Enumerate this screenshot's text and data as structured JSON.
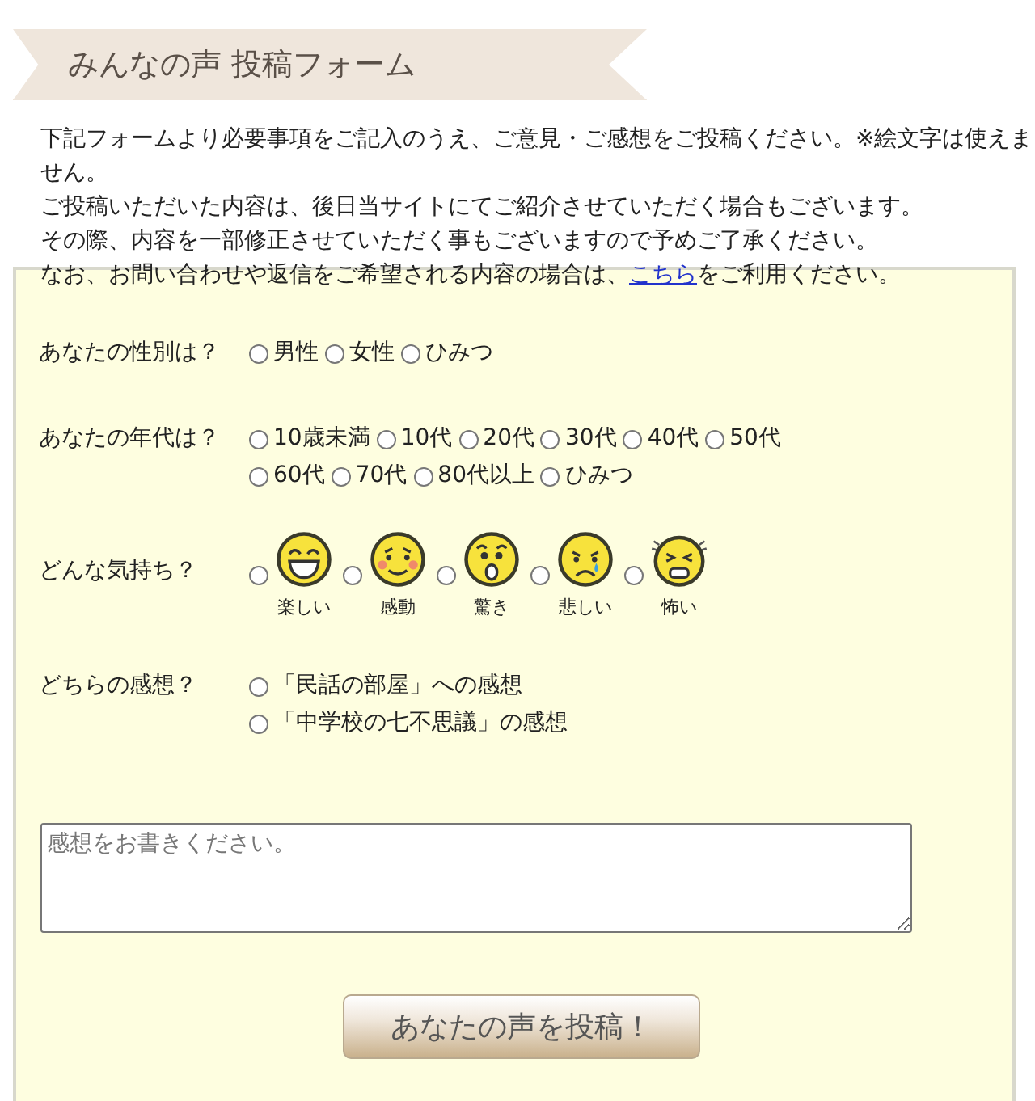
{
  "banner": {
    "title": "みんなの声 投稿フォーム"
  },
  "intro": {
    "lines": [
      {
        "text": "下記フォームより必要事項をご記入のうえ、ご意見・ご感想をご投稿ください。※絵文字は使えません。"
      },
      {
        "text": "ご投稿いただいた内容は、後日当サイトにてご紹介させていただく場合もございます。"
      },
      {
        "text": "その際、内容を一部修正させていただく事もございますので予めご了承ください。"
      },
      {
        "text": "なお、お問い合わせや返信をご希望される内容の場合は、",
        "link": "こちら",
        "after": "をご利用ください。"
      }
    ]
  },
  "questions": [
    {
      "kind": "inline",
      "label": "あなたの性別は？",
      "options": [
        {
          "label": "男性",
          "selected": false
        },
        {
          "label": "女性",
          "selected": false
        },
        {
          "label": "ひみつ",
          "selected": false
        }
      ]
    },
    {
      "kind": "inline",
      "label": "あなたの年代は？",
      "options": [
        {
          "label": "10歳未満",
          "selected": false
        },
        {
          "label": "10代",
          "selected": false
        },
        {
          "label": "20代",
          "selected": false
        },
        {
          "label": "30代",
          "selected": false
        },
        {
          "label": "40代",
          "selected": false
        },
        {
          "label": "50代",
          "selected": false
        },
        {
          "label": "60代",
          "selected": false
        },
        {
          "label": "70代",
          "selected": false
        },
        {
          "label": "80代以上",
          "selected": false
        },
        {
          "label": "ひみつ",
          "selected": false
        }
      ]
    },
    {
      "kind": "faces",
      "label": "どんな気持ち？",
      "options": [
        {
          "label": "楽しい",
          "selected": false
        },
        {
          "label": "感動",
          "selected": false
        },
        {
          "label": "驚き",
          "selected": false
        },
        {
          "label": "悲しい",
          "selected": false
        },
        {
          "label": "怖い",
          "selected": false
        }
      ]
    },
    {
      "kind": "stacked",
      "label": "どちらの感想？",
      "options": [
        {
          "label": "「民話の部屋」への感想",
          "selected": false
        },
        {
          "label": "「中学校の七不思議」の感想",
          "selected": false
        }
      ]
    }
  ],
  "comment": {
    "placeholder": "感想をお書きください。"
  },
  "submit": {
    "label": "あなたの声を投稿！"
  }
}
